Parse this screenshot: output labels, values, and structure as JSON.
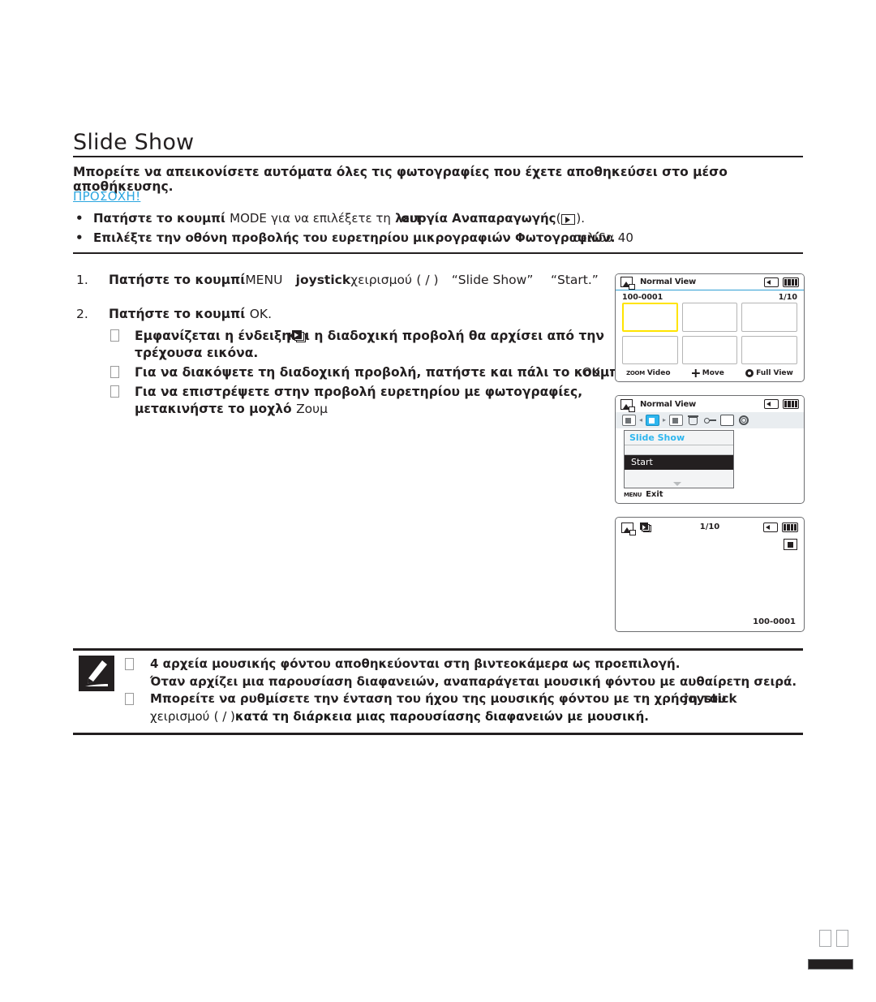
{
  "page": {
    "title": "Slide Show",
    "intro": "Μπορείτε να απεικονίσετε αυτόματα όλες τις φωτογραφίες που έχετε αποθηκεύσει στο μέσο αποθήκευσης.",
    "caution_label": "ΠΡΟΣΟΧΗ!",
    "caution_color": "#2ba6e0"
  },
  "caution_bullets": [
    {
      "marker": "•",
      "part1": "Πατήστε το κουμπί",
      "part2": "MODE",
      "part3": "για να επιλέξετε τη",
      "part4": "λειτ",
      "part5": "ουργία Αναπαραγωγής",
      "part6": "(",
      "part7": ")."
    },
    {
      "marker": "•",
      "part1": "Επιλέξτε την οθόνη προβολής του ευρετηρίου μικρογραφιών Φωτογραφιών.",
      "part2": "σελίδα 40"
    }
  ],
  "steps": [
    {
      "num": "1.",
      "t1": "Πατήστε το κουμπί",
      "t2": "MENU",
      "t3": "joystick",
      "t4": "χειρισμού",
      "t5": "(  /  )",
      "t6": "“Slide Show”",
      "t7": "“Start.”"
    },
    {
      "num": "2.",
      "t1": "Πατήστε το κουμπί",
      "t2": "OK."
    }
  ],
  "substeps": [
    {
      "line1a": "Εμφανίζεται η ένδειξη",
      "line1b": "και η διαδοχική προβολή θα αρχίσει από την",
      "line2": "τρέχουσα εικόνα."
    },
    {
      "line1a": "Για να διακόψετε τη διαδοχική προβολή, πατήστε και πάλι το κουμπί",
      "line1b": "OK."
    },
    {
      "line1": "Για να επιστρέψετε στην προβολή ευρετηρίου με φωτογραφίες,",
      "line2a": "μετακινήστε το μοχλό",
      "line2b": "Ζουμ"
    }
  ],
  "lcd1": {
    "mode_label": "Normal View",
    "file_no": "100-0001",
    "counter": "1/10",
    "foot": {
      "zoom_tag": "ZOOM",
      "zoom_label": "Video",
      "move_label": "Move",
      "full_label": "Full View"
    },
    "thumbs": [
      {
        "selected": true
      },
      {
        "selected": false
      },
      {
        "selected": false
      },
      {
        "selected": false
      },
      {
        "selected": false
      },
      {
        "selected": false
      }
    ],
    "selection_color": "#ffe400"
  },
  "lcd2": {
    "mode_label": "Normal View",
    "menu_title": "Slide Show",
    "menu_selected": "Start",
    "menu_tabs": [
      "play-photo-tab-icon",
      "slideshow-tab-icon",
      "play-video-tab-icon",
      "trash-tab-icon",
      "protect-key-tab-icon",
      "file-info-tab-icon",
      "settings-gear-tab-icon"
    ],
    "exit_tag": "MENU",
    "exit_label": "Exit"
  },
  "lcd3": {
    "counter": "1/10",
    "file_no": "100-0001",
    "arrow_color": "#e8242a"
  },
  "note": {
    "items": [
      {
        "line1": "4 αρχεία μουσικής φόντου αποθηκεύονται στη βιντεοκάμερα ως προεπιλογή.",
        "line2": "Όταν αρχίζει μια παρουσίαση διαφανειών, αναπαράγεται μουσική φόντου με αυθαίρετη σειρά."
      },
      {
        "line1a": "Μπορείτε να ρυθμίσετε την ένταση του ήχου της μουσικής φόντου με τη χρήση του",
        "line1b": "joystick",
        "line2a": "χειρισμού",
        "line2b": "(  /  )",
        "line2c": "κατά τη διάρκεια μιας παρουσίασης διαφανειών με μουσική."
      }
    ]
  },
  "footer": {
    "boxes": [
      "",
      ""
    ]
  }
}
